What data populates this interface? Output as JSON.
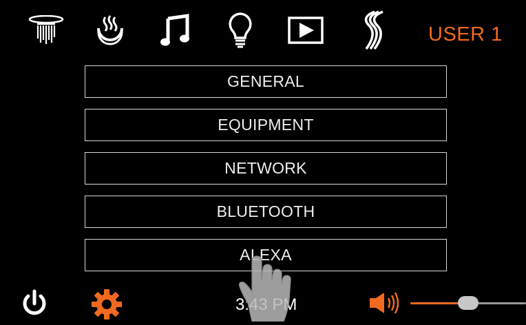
{
  "header": {
    "icons": [
      {
        "name": "shower-icon"
      },
      {
        "name": "heat-icon"
      },
      {
        "name": "music-icon"
      },
      {
        "name": "light-bulb-icon"
      },
      {
        "name": "play-icon"
      },
      {
        "name": "steam-icon"
      }
    ],
    "user_label": "USER 1"
  },
  "menu": {
    "items": [
      {
        "label": "GENERAL"
      },
      {
        "label": "EQUIPMENT"
      },
      {
        "label": "NETWORK"
      },
      {
        "label": "BLUETOOTH"
      },
      {
        "label": "ALEXA"
      }
    ]
  },
  "footer": {
    "time": "3:43 PM",
    "volume_level": 0.5
  },
  "colors": {
    "accent": "#f26a21",
    "background": "#000000",
    "text": "#ffffff"
  }
}
